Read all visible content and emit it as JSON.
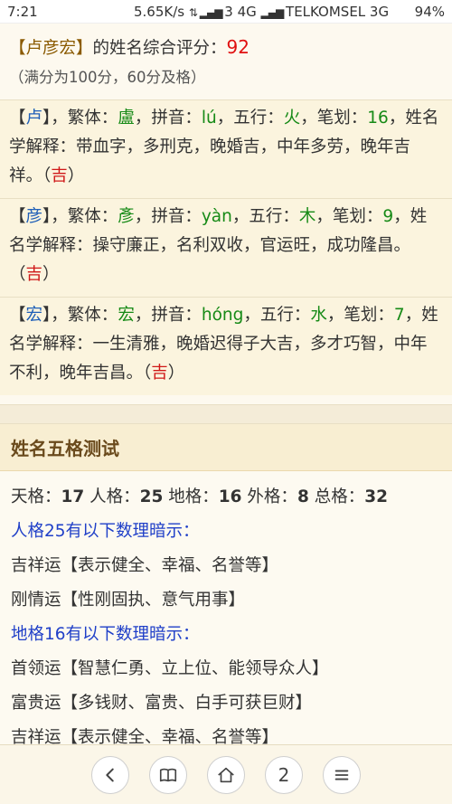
{
  "status_bar": {
    "time": "7:21",
    "network": "5.65K/s",
    "carrier1": "3 4G",
    "carrier2": "TELKOMSEL 3G",
    "battery": "94%"
  },
  "score": {
    "name": "【卢彦宏】",
    "text": "的姓名综合评分：",
    "value": "92",
    "note": "（满分为100分，60分及格）"
  },
  "characters": [
    {
      "bracket_open": "【",
      "char": "卢",
      "bracket_close": "】",
      "trad_label": "，繁体：",
      "trad": "盧",
      "pinyin_label": "，拼音：",
      "pinyin": "lú",
      "wuxing_label": "，五行：",
      "wuxing": "火",
      "strokes_label": "，笔划：",
      "strokes": "16",
      "meaning_label": "，姓名学解释：",
      "meaning": "带血字，多刑克，晚婚吉，中年多劳，晚年吉祥。",
      "luck": "吉"
    },
    {
      "bracket_open": "【",
      "char": "彦",
      "bracket_close": "】",
      "trad_label": "，繁体：",
      "trad": "彥",
      "pinyin_label": "，拼音：",
      "pinyin": "yàn",
      "wuxing_label": "，五行：",
      "wuxing": "木",
      "strokes_label": "，笔划：",
      "strokes": "9",
      "meaning_label": "，姓名学解释：",
      "meaning": "操守廉正，名利双收，官运旺，成功隆昌。",
      "luck": "吉"
    },
    {
      "bracket_open": "【",
      "char": "宏",
      "bracket_close": "】",
      "trad_label": "，繁体：",
      "trad": "宏",
      "pinyin_label": "，拼音：",
      "pinyin": "hóng",
      "wuxing_label": "，五行：",
      "wuxing": "水",
      "strokes_label": "，笔划：",
      "strokes": "7",
      "meaning_label": "，姓名学解释：",
      "meaning": "一生清雅，晚婚迟得子大吉，多才巧智，中年不利，晚年吉昌。",
      "luck": "吉"
    }
  ],
  "wuge": {
    "title": "姓名五格测试",
    "tian_label": "天格：",
    "tian": "17",
    "ren_label": " 人格：",
    "ren": "25",
    "di_label": " 地格：",
    "di": "16",
    "wai_label": " 外格：",
    "wai": "8",
    "zong_label": " 总格：",
    "zong": "32",
    "renge_hint": "人格25有以下数理暗示：",
    "renge_items": [
      "吉祥运【表示健全、幸福、名誉等】",
      "刚情运【性刚固执、意气用事】"
    ],
    "dige_hint": "地格16有以下数理暗示：",
    "dige_items": [
      "首领运【智慧仁勇、立上位、能领导众人】",
      "富贵运【多钱财、富贵、白手可获巨财】",
      "吉祥运【表示健全、幸福、名誉等】"
    ]
  },
  "nav": {
    "back_icon": "chevron-left-icon",
    "book_icon": "book-icon",
    "home_icon": "home-icon",
    "tabs_count": "2",
    "menu_icon": "menu-icon"
  }
}
